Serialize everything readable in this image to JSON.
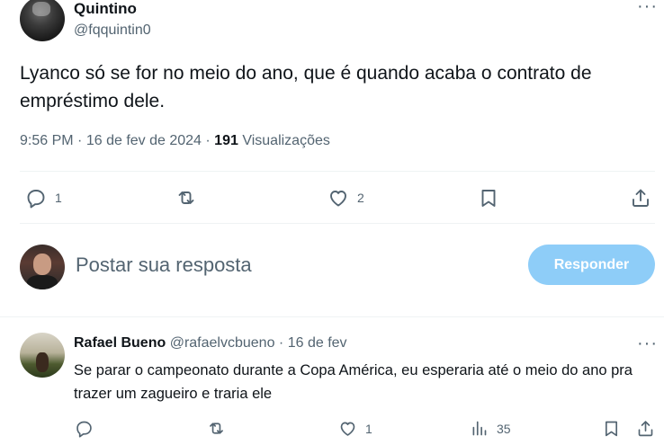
{
  "tweet": {
    "author_name": "Quintino",
    "author_handle": "@fqquintin0",
    "text": "Lyanco só se for no meio do ano, que é quando acaba o contrato de empréstimo dele.",
    "time": "9:56 PM",
    "date": "16 de fev de 2024",
    "separator": "·",
    "views_count": "191",
    "views_label": "Visualizações",
    "more_label": "···",
    "actions": {
      "reply_count": "1",
      "retweet_count": "",
      "like_count": "2"
    }
  },
  "composer": {
    "placeholder": "Postar sua resposta",
    "button_label": "Responder",
    "button_color": "#8ecdf8"
  },
  "reply": {
    "author_name": "Rafael Bueno",
    "author_handle": "@rafaelvcbueno",
    "separator": "·",
    "date": "16 de fev",
    "text": "Se parar o campeonato durante a Copa América, eu esperaria até o meio do ano pra trazer um zagueiro e traria ele",
    "more_label": "···",
    "actions": {
      "reply_count": "",
      "retweet_count": "",
      "like_count": "1",
      "views_count": "35"
    }
  },
  "colors": {
    "text_primary": "#0f1419",
    "text_secondary": "#536471",
    "divider": "#eff3f4"
  },
  "icons": [
    "reply-icon",
    "retweet-icon",
    "like-icon",
    "bookmark-icon",
    "share-icon",
    "views-icon",
    "more-icon"
  ]
}
